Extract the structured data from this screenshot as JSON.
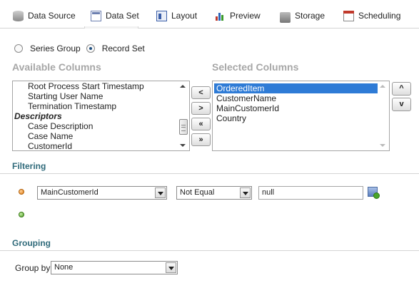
{
  "tabs": [
    {
      "label": "Data Source",
      "icon": "database-icon"
    },
    {
      "label": "Data Set",
      "icon": "dataset-icon",
      "active": true
    },
    {
      "label": "Layout",
      "icon": "layout-icon"
    },
    {
      "label": "Preview",
      "icon": "bar-chart-icon"
    },
    {
      "label": "Storage",
      "icon": "storage-drive-icon"
    },
    {
      "label": "Scheduling",
      "icon": "calendar-icon"
    }
  ],
  "mode": {
    "series_group_label": "Series Group",
    "record_set_label": "Record Set",
    "selected": "Record Set"
  },
  "available": {
    "heading": "Available Columns",
    "items": [
      {
        "label": "Root Process Start Timestamp",
        "group": false
      },
      {
        "label": "Starting User Name",
        "group": false
      },
      {
        "label": "Termination Timestamp",
        "group": false
      },
      {
        "label": "Descriptors",
        "group": true
      },
      {
        "label": "Case Description",
        "group": false
      },
      {
        "label": "Case Name",
        "group": false
      },
      {
        "label": "CustomerId",
        "group": false
      }
    ]
  },
  "move_buttons": {
    "add": "<",
    "remove": ">",
    "add_all": "«",
    "remove_all": "»"
  },
  "selected": {
    "heading": "Selected Columns",
    "items": [
      "OrderedItem",
      "CustomerName",
      "MainCustomerId",
      "Country"
    ],
    "selected_item": "OrderedItem",
    "up_label": "^",
    "down_label": "v"
  },
  "filtering": {
    "heading": "Filtering",
    "rows": [
      {
        "column": "MainCustomerId",
        "operator": "Not Equal",
        "value": "null"
      }
    ]
  },
  "grouping": {
    "heading": "Grouping",
    "group_by_label": "Group by",
    "group_by_value": "None"
  },
  "colors": {
    "section_title": "#2f6a7a",
    "heading_gray": "#a7a7a7",
    "selection": "#2e7bd6"
  }
}
